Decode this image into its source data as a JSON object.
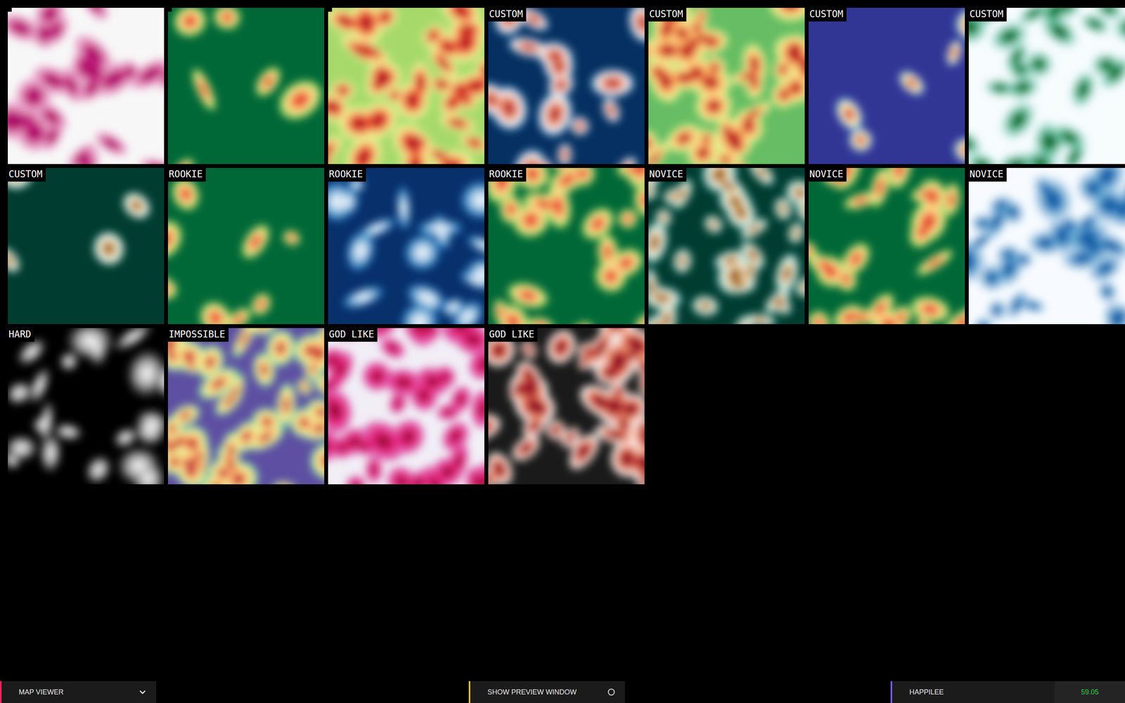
{
  "maps": [
    {
      "label": "",
      "level": 0.55,
      "palette": [
        "#f7f7f7",
        "#e9a3c9",
        "#c51b7d",
        "#8e0152"
      ]
    },
    {
      "label": "",
      "level": 0.1,
      "palette": [
        "#006837",
        "#a6d96a",
        "#fee08b",
        "#f46d43",
        "#d73027"
      ]
    },
    {
      "label": "",
      "level": 0.9,
      "palette": [
        "#a6d96a",
        "#d9ef8b",
        "#fee08b",
        "#f46d43",
        "#d73027",
        "#a50026"
      ]
    },
    {
      "label": "CUSTOM",
      "level": 0.35,
      "palette": [
        "#053061",
        "#4393c3",
        "#f7f7f7",
        "#f4a582",
        "#d6604d",
        "#b2182b"
      ]
    },
    {
      "label": "CUSTOM",
      "level": 0.9,
      "palette": [
        "#66bd63",
        "#d9ef8b",
        "#fee08b",
        "#fdae61",
        "#d73027",
        "#a50026"
      ]
    },
    {
      "label": "CUSTOM",
      "level": 0.12,
      "palette": [
        "#313695",
        "#74add1",
        "#ffffbf",
        "#f46d43",
        "#a50026"
      ]
    },
    {
      "label": "CUSTOM",
      "level": 0.7,
      "palette": [
        "#f7fcfd",
        "#ccece6",
        "#66c2a4",
        "#238b45",
        "#00441b"
      ]
    },
    {
      "label": "CUSTOM",
      "level": 0.05,
      "palette": [
        "#003c30",
        "#c7eae5",
        "#f6e8c3",
        "#bf812d",
        "#8c510a"
      ]
    },
    {
      "label": "ROOKIE",
      "level": 0.15,
      "palette": [
        "#006837",
        "#a6d96a",
        "#fee08b",
        "#f46d43",
        "#d73027"
      ]
    },
    {
      "label": "ROOKIE",
      "level": 0.45,
      "palette": [
        "#08306b",
        "#2171b5",
        "#6baed6",
        "#c6dbef",
        "#f7fbff"
      ]
    },
    {
      "label": "ROOKIE",
      "level": 0.55,
      "palette": [
        "#006837",
        "#a6d96a",
        "#fee08b",
        "#f46d43",
        "#d73027"
      ]
    },
    {
      "label": "NOVICE",
      "level": 0.8,
      "palette": [
        "#003c30",
        "#35978f",
        "#c7eae5",
        "#f6e8c3",
        "#bf812d",
        "#8c510a"
      ]
    },
    {
      "label": "NOVICE",
      "level": 0.55,
      "palette": [
        "#006837",
        "#a6d96a",
        "#fee08b",
        "#f46d43",
        "#d73027"
      ]
    },
    {
      "label": "NOVICE",
      "level": 0.75,
      "palette": [
        "#f7fbff",
        "#c6dbef",
        "#6baed6",
        "#2171b5",
        "#08519c"
      ]
    },
    {
      "label": "HARD",
      "level": 0.45,
      "palette": [
        "#000000",
        "#525252",
        "#bdbdbd",
        "#ffffff"
      ]
    },
    {
      "label": "IMPOSSIBLE",
      "level": 1,
      "palette": [
        "#5e4fa2",
        "#66c2a5",
        "#e6f598",
        "#fee08b",
        "#f46d43",
        "#9e0142"
      ]
    },
    {
      "label": "GOD LIKE",
      "level": 0.9,
      "palette": [
        "#f1eef6",
        "#df65b0",
        "#e7298a",
        "#ce1256",
        "#67001f"
      ]
    },
    {
      "label": "GOD LIKE",
      "level": 0.9,
      "palette": [
        "#1a1a1a",
        "#ffffff",
        "#f4a582",
        "#d6604d",
        "#b2182b",
        "#67001f"
      ]
    }
  ],
  "toolbar": {
    "dropdown": {
      "label": "MAP VIEWER",
      "expanded": false
    },
    "preview": {
      "label": "SHOW PREVIEW WINDOW",
      "checked": false
    },
    "user": {
      "name": "HAPPILEE",
      "value": "59.05"
    }
  }
}
